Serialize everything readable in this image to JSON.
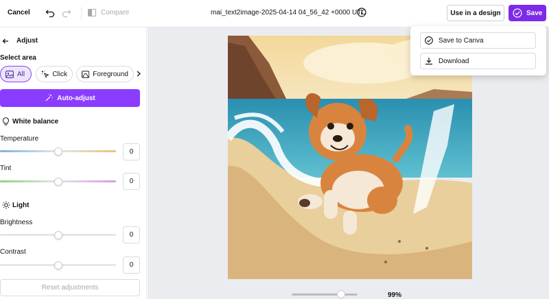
{
  "topbar": {
    "cancel_label": "Cancel",
    "compare_label": "Compare",
    "filename": "mai_text2image-2025-04-14 04_56_42 +0000 UTC",
    "use_in_design_label": "Use in a design",
    "save_label": "Save"
  },
  "save_menu": {
    "items": [
      {
        "label": "Save to Canva",
        "icon": "check-circle-icon"
      },
      {
        "label": "Download",
        "icon": "download-icon"
      }
    ]
  },
  "panel": {
    "title": "Adjust",
    "select_area_label": "Select area",
    "area_options": [
      {
        "label": "All",
        "icon": "image-icon",
        "selected": true
      },
      {
        "label": "Click",
        "icon": "magic-cursor-icon",
        "selected": false
      },
      {
        "label": "Foreground",
        "icon": "foreground-icon",
        "selected": false
      }
    ],
    "auto_adjust_label": "Auto-adjust",
    "white_balance": {
      "title": "White balance",
      "temperature": {
        "label": "Temperature",
        "value": "0"
      },
      "tint": {
        "label": "Tint",
        "value": "0"
      }
    },
    "light": {
      "title": "Light",
      "brightness": {
        "label": "Brightness",
        "value": "0"
      },
      "contrast": {
        "label": "Contrast",
        "value": "0"
      }
    },
    "reset_label": "Reset adjustments"
  },
  "canvas": {
    "zoom_label": "99%",
    "zoom_level": 0.69
  },
  "colors": {
    "accent": "#7d2ae8",
    "accent_light": "#8b3dff"
  }
}
